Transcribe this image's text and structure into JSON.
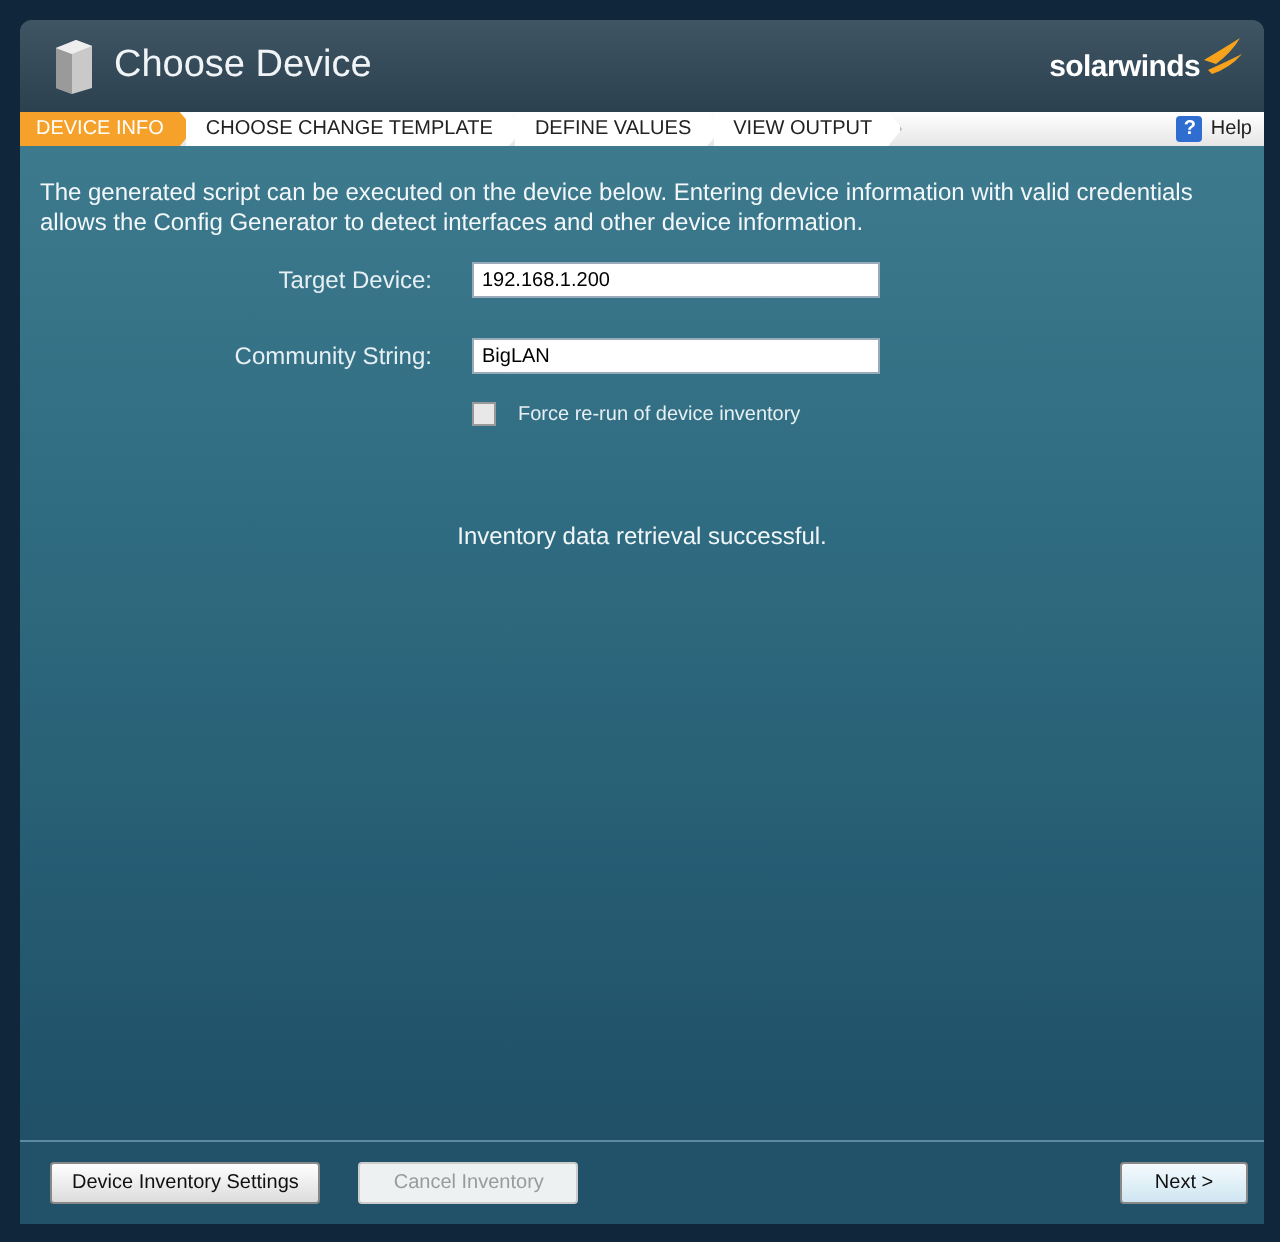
{
  "window": {
    "title": "Choose Device",
    "brand": "solarwinds"
  },
  "steps": [
    {
      "label": "DEVICE INFO",
      "selected": true
    },
    {
      "label": "CHOOSE CHANGE TEMPLATE",
      "selected": false
    },
    {
      "label": "DEFINE VALUES",
      "selected": false
    },
    {
      "label": "VIEW OUTPUT",
      "selected": false
    }
  ],
  "help_icon": "?",
  "help": "Help",
  "intro": "The generated script can be executed on the device below. Entering device information with valid credentials allows the Config Generator to detect interfaces and other device information.",
  "fields": [
    {
      "label": "Target Device:",
      "value": "192.168.1.200"
    },
    {
      "label": "Community String:",
      "value": "BigLAN"
    }
  ],
  "force_rerun": {
    "label": "Force re-run of device inventory",
    "checked": false
  },
  "status": "Inventory data retrieval successful.",
  "buttons": [
    {
      "label": "Device Inventory Settings",
      "disabled": false,
      "kind": "left"
    },
    {
      "label": "Cancel Inventory",
      "disabled": true,
      "kind": "left"
    },
    {
      "label": "Next >",
      "disabled": false,
      "kind": "right"
    }
  ]
}
